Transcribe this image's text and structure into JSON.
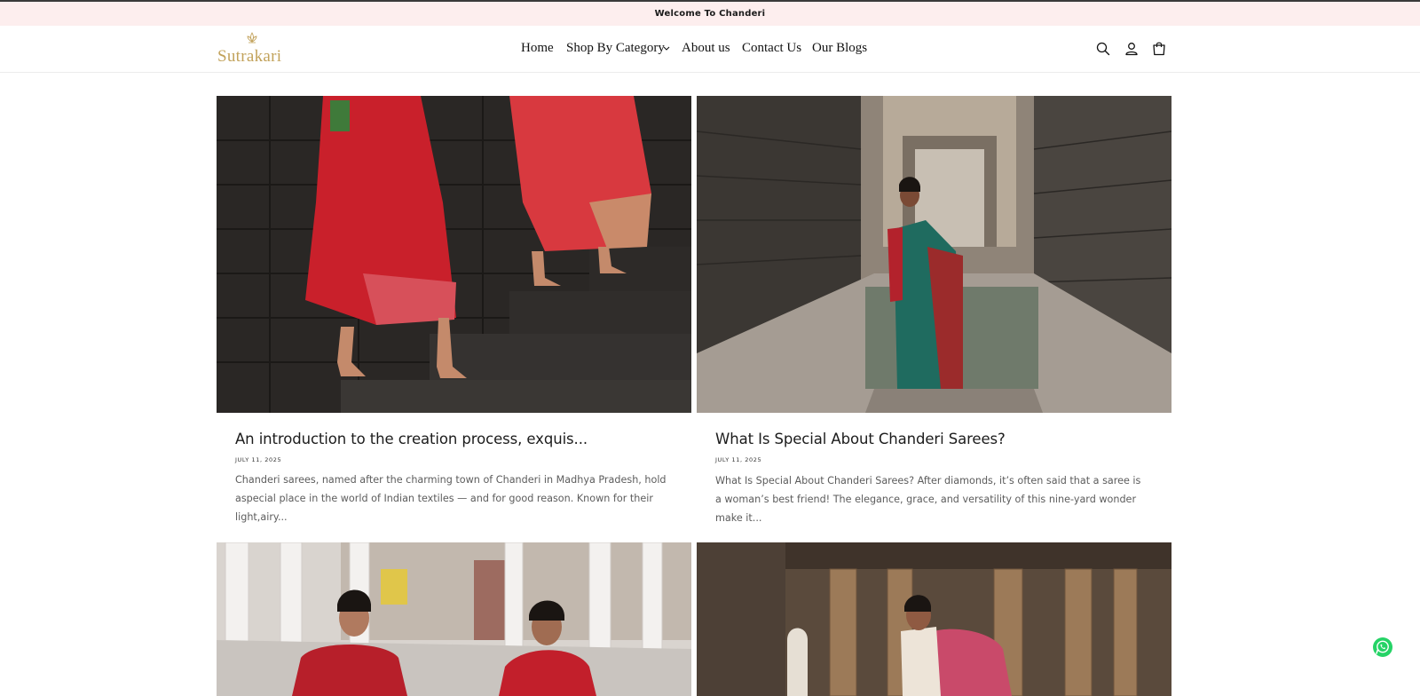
{
  "announcement": {
    "text": "Welcome To Chanderi"
  },
  "header": {
    "logo_text": "Sutrakari",
    "nav": [
      {
        "label": "Home"
      },
      {
        "label": "Shop By Category"
      },
      {
        "label": "About us"
      },
      {
        "label": "Contact Us"
      },
      {
        "label": "Our Blogs"
      }
    ],
    "icons": [
      "search-icon",
      "account-icon",
      "cart-icon"
    ]
  },
  "blog": {
    "posts": [
      {
        "title": "An introduction to the creation process, exquis...",
        "date": "JULY 11, 2025",
        "excerpt": "Chanderi sarees, named after the charming town of Chanderi in Madhya Pradesh, hold aspecial place in the world of Indian textiles — and for good reason. Known for their light,airy..."
      },
      {
        "title": "What Is Special About Chanderi Sarees?",
        "date": "JULY 11, 2025",
        "excerpt": "What Is Special About Chanderi Sarees?  After diamonds, it’s often said that a saree is a woman’s best friend! The elegance, grace, and versatility of this nine-yard wonder make it..."
      },
      {
        "title": "",
        "date": "",
        "excerpt": ""
      },
      {
        "title": "",
        "date": "",
        "excerpt": ""
      }
    ]
  },
  "colors": {
    "announcement_bg": "#fdeeee",
    "logo_gold": "#c2a25b",
    "whatsapp_green": "#25d366"
  }
}
